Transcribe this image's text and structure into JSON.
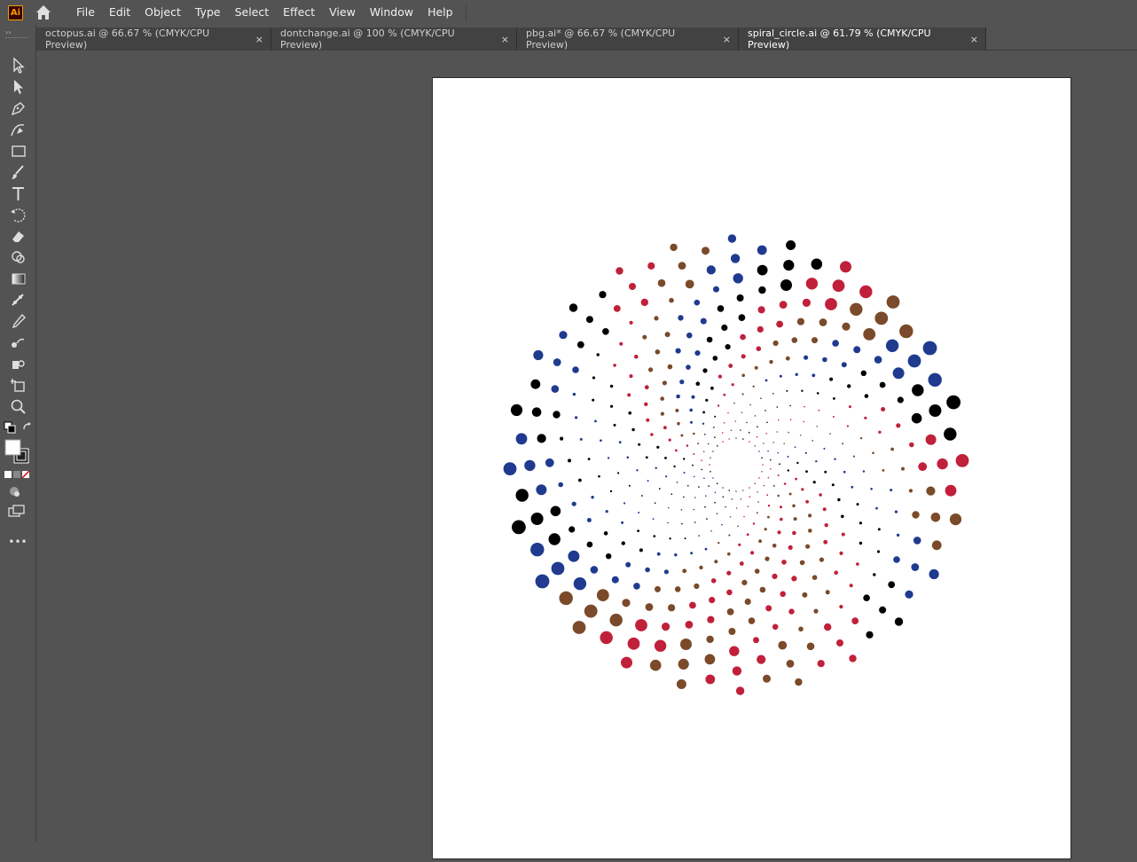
{
  "app": {
    "logo_text": "Ai"
  },
  "menu": [
    "File",
    "Edit",
    "Object",
    "Type",
    "Select",
    "Effect",
    "View",
    "Window",
    "Help"
  ],
  "tabs": [
    {
      "label": "octopus.ai @ 66.67 % (CMYK/CPU Preview)",
      "close": "×",
      "active": false
    },
    {
      "label": "dontchange.ai @ 100 % (CMYK/CPU Preview)",
      "close": "×",
      "active": false
    },
    {
      "label": "pbg.ai* @ 66.67 % (CMYK/CPU Preview)",
      "close": "×",
      "active": false
    },
    {
      "label": "spiral_circle.ai @ 61.79 % (CMYK/CPU Preview)",
      "close": "×",
      "active": true
    }
  ],
  "toolbar": {
    "grip": "››",
    "tools": [
      "selection-tool",
      "direct-selection-tool",
      "pen-tool",
      "curvature-tool",
      "rectangle-tool",
      "paintbrush-tool",
      "type-tool",
      "rotate-tool",
      "eraser-tool",
      "shape-builder-tool",
      "gradient-tool",
      "puppet-warp-tool",
      "eyedropper-tool",
      "blend-tool",
      "symbol-sprayer-tool",
      "artboard-tool",
      "zoom-tool"
    ],
    "more": "•••"
  },
  "artwork": {
    "palette": [
      "#c1203a",
      "#7a4a2a",
      "#1f3a8f",
      "#000000"
    ]
  }
}
